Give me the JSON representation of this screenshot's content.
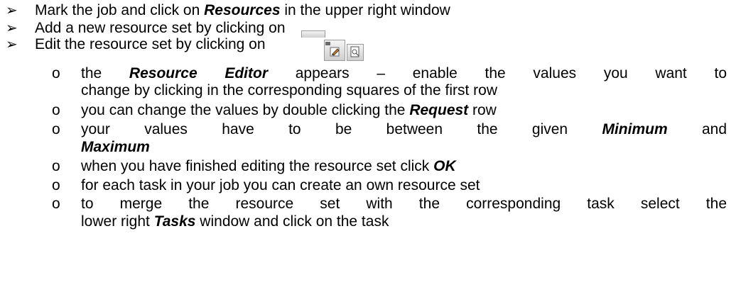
{
  "bullets": {
    "arrow": "➢",
    "sub": "o"
  },
  "items": [
    {
      "pre": "Mark the job and click on ",
      "em": "Resources",
      "post": " in the upper right window"
    },
    {
      "text": "Add a new resource set by clicking on "
    },
    {
      "text": "Edit the resource set by clicking on "
    }
  ],
  "sub_items": {
    "s1a_pre": "the ",
    "s1a_em": "Resource Editor",
    "s1a_post": " appears – enable the values you want to",
    "s1b": "change by clicking in the corresponding squares of the first row",
    "s2_pre": "you can change the values by double clicking the ",
    "s2_em": "Request",
    "s2_post": " row",
    "s3a_pre": "your values have to be between the given ",
    "s3a_em": "Minimum",
    "s3a_post": " and",
    "s3b_em": "Maximum",
    "s4_pre": "when you have finished editing the resource set click ",
    "s4_em": "OK",
    "s5": "for each task in your job you can create an own resource set",
    "s6a": "to merge the resource set with the corresponding task select the",
    "s6b_pre": "lower right ",
    "s6b_em": "Tasks",
    "s6b_post": " window and click on the task"
  },
  "icons": [
    "add-resource-set-icon",
    "edit-resource-set-icon",
    "resource-set-icon"
  ]
}
